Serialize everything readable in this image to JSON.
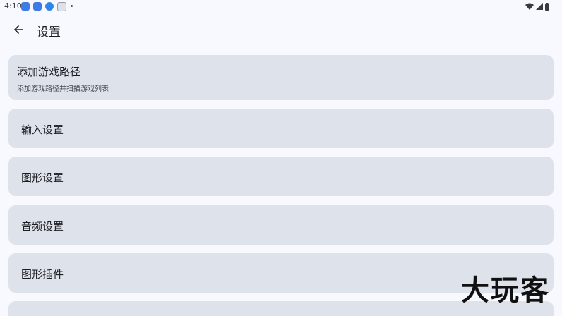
{
  "status_bar": {
    "time": "4:10",
    "icons": [
      "app-notification-icon",
      "app-notification-icon",
      "download-icon",
      "shield-icon",
      "dot-icon",
      "wifi-icon",
      "signal-icon",
      "battery-icon"
    ]
  },
  "app_bar": {
    "back_icon": "arrow-left-icon",
    "title": "设置"
  },
  "settings": {
    "items": [
      {
        "title": "添加游戏路径",
        "subtitle": "添加游戏路径并扫描游戏列表"
      },
      {
        "title": "输入设置"
      },
      {
        "title": "图形设置"
      },
      {
        "title": "音频设置"
      },
      {
        "title": "图形插件"
      }
    ]
  },
  "watermark": {
    "text": "大玩客"
  },
  "colors": {
    "background": "#f8f9ff",
    "card": "#dee2ea",
    "text": "#1b1c20",
    "subtitle": "#45474d"
  }
}
